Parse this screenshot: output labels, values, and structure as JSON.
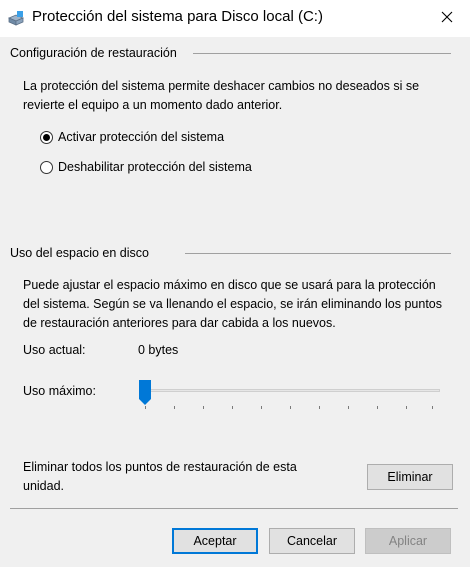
{
  "window": {
    "title": "Protección del sistema para Disco local (C:)"
  },
  "restore_settings": {
    "header": "Configuración de restauración",
    "description": "La protección del sistema permite deshacer cambios no deseados si se revierte el equipo a un momento dado anterior.",
    "options": [
      {
        "label": "Activar protección del sistema",
        "selected": true
      },
      {
        "label": "Deshabilitar protección del sistema",
        "selected": false
      }
    ]
  },
  "disk_usage": {
    "header": "Uso del espacio en disco",
    "description": "Puede ajustar el espacio máximo en disco que se usará para la protección del sistema. Según se va llenando el espacio, se irán eliminando los puntos de restauración anteriores para dar cabida a los nuevos.",
    "current_label": "Uso actual:",
    "current_value": "0 bytes",
    "max_label": "Uso máximo:",
    "max_slider_fraction": 0
  },
  "delete": {
    "text": "Eliminar todos los puntos de restauración de esta unidad.",
    "button_label": "Eliminar"
  },
  "footer": {
    "ok_label": "Aceptar",
    "cancel_label": "Cancelar",
    "apply_label": "Aplicar"
  },
  "colors": {
    "accent": "#0078d7",
    "window_bg": "#f0f0f0"
  }
}
